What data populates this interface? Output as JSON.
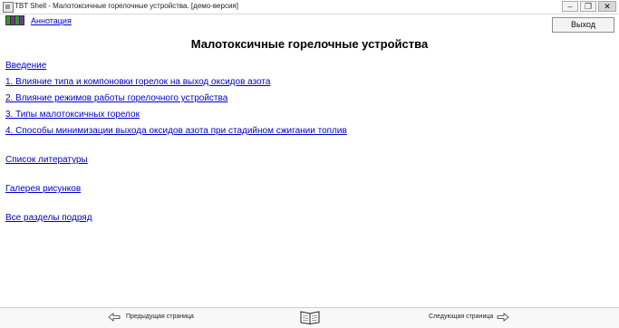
{
  "window": {
    "title": "TBT Shell - Малотоксичные горелочные устройства. [демо-версия]"
  },
  "toolbar": {
    "annotation_label": "Аннотация",
    "exit_label": "Выход"
  },
  "page": {
    "title": "Малотоксичные горелочные устройства",
    "links": [
      "Введение",
      "1. Влияние типа и компоновки горелок на выход оксидов азота",
      "2. Влияние режимов работы горелочного устройства",
      "3. Типы малотоксичных горелок",
      "4. Способы минимизации выхода оксидов азота при стадийном сжигании топлив",
      "Список литературы",
      "Галерея рисунков",
      "Все разделы подряд"
    ]
  },
  "footer": {
    "prev_label": "Предыдущая страница",
    "next_label": "Следующая страница"
  },
  "colors": {
    "link": "#0000cc",
    "book_green": "#2e9b2e",
    "book_purple": "#6a3c8c"
  },
  "icons": [
    "app-icon",
    "book-icon",
    "left-arrow-icon",
    "right-arrow-icon",
    "open-book-icon"
  ]
}
